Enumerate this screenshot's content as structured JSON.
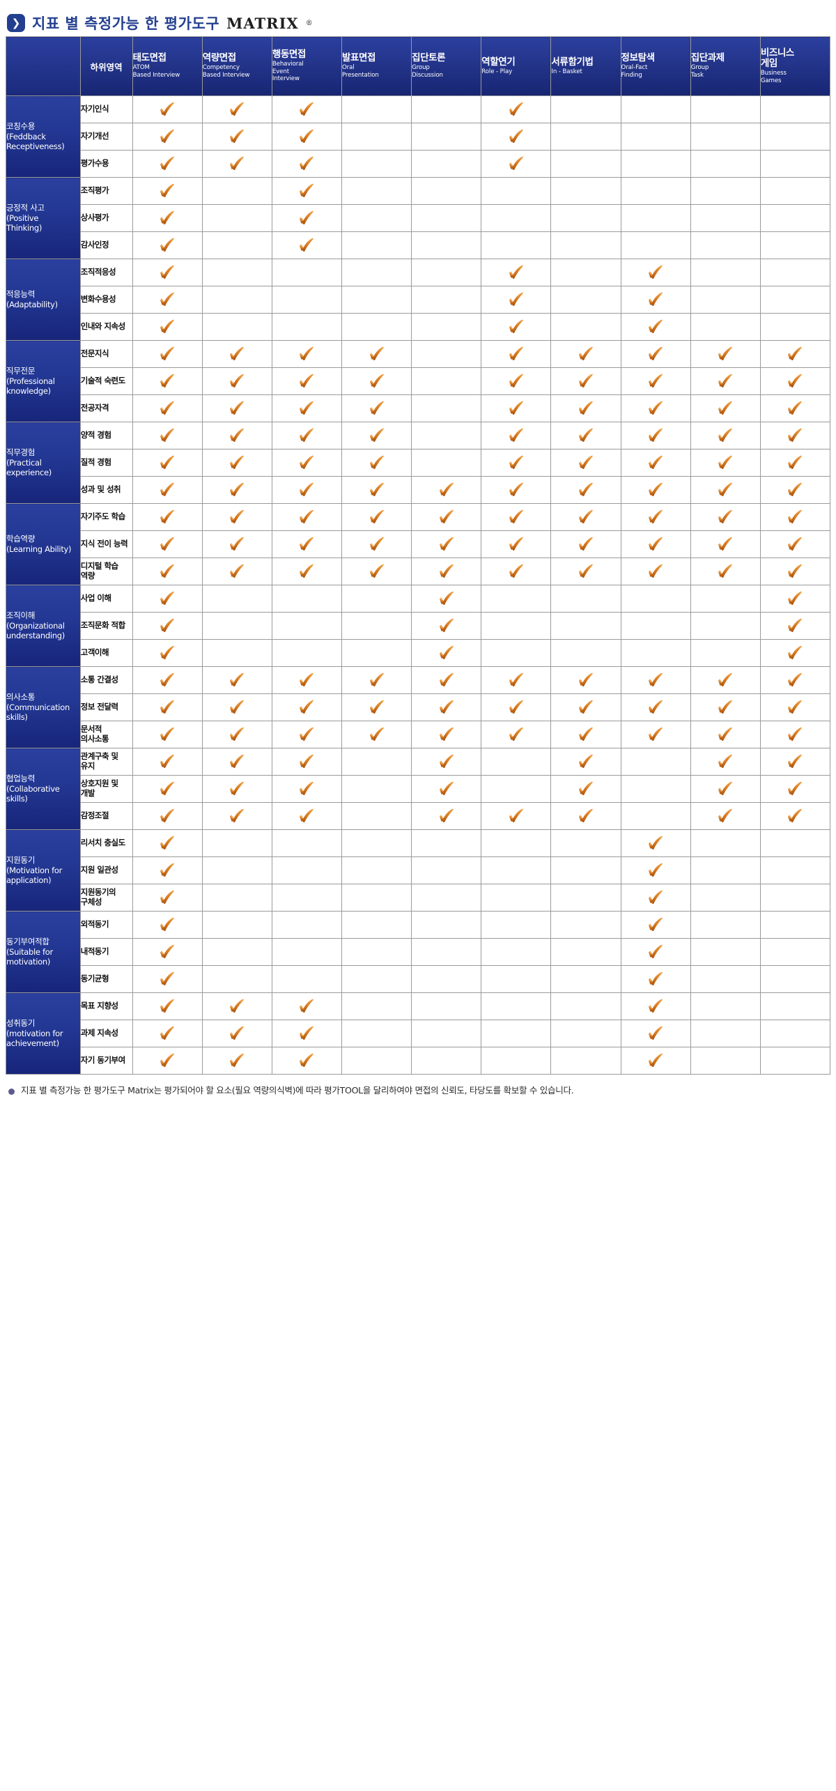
{
  "page": {
    "title_kr": "지표 별 측정가능 한 평가도구",
    "title_matrix": "MATRIX",
    "title_reg": "®",
    "chevron_icon": "chevron-right-icon",
    "accent_color": "#233f8f",
    "header_bg": "#23348a",
    "check_color": "#d4761e"
  },
  "header": {
    "category_label": "",
    "subarea_label": "하위영역",
    "tools": [
      {
        "kr": "태도면접",
        "en": "ATOM\nBased Interview"
      },
      {
        "kr": "역량면접",
        "en": "Competency\nBased Interview"
      },
      {
        "kr": "행동면접",
        "en": "Behavioral\nEvent\nInterview"
      },
      {
        "kr": "발표면접",
        "en": "Oral\nPresentation"
      },
      {
        "kr": "집단토론",
        "en": "Group\nDiscussion"
      },
      {
        "kr": "역할연기",
        "en": "Role - Play"
      },
      {
        "kr": "서류함기법",
        "en": "In - Basket"
      },
      {
        "kr": "정보탐색",
        "en": "Oral-Fact\nFinding"
      },
      {
        "kr": "집단과제",
        "en": "Group\nTask"
      },
      {
        "kr": "비즈니스\n게임",
        "en": "Business\nGames"
      }
    ]
  },
  "categories": [
    {
      "kr": "코칭수용",
      "en": "(Feddback\nReceptiveness)",
      "rows": [
        {
          "sub": "자기인식",
          "marks": [
            1,
            1,
            1,
            0,
            0,
            1,
            0,
            0,
            0,
            0
          ]
        },
        {
          "sub": "자기개선",
          "marks": [
            1,
            1,
            1,
            0,
            0,
            1,
            0,
            0,
            0,
            0
          ]
        },
        {
          "sub": "평가수용",
          "marks": [
            1,
            1,
            1,
            0,
            0,
            1,
            0,
            0,
            0,
            0
          ]
        }
      ]
    },
    {
      "kr": "긍정적 사고",
      "en": "(Positive\nThinking)",
      "rows": [
        {
          "sub": "조직평가",
          "marks": [
            1,
            0,
            1,
            0,
            0,
            0,
            0,
            0,
            0,
            0
          ]
        },
        {
          "sub": "상사평가",
          "marks": [
            1,
            0,
            1,
            0,
            0,
            0,
            0,
            0,
            0,
            0
          ]
        },
        {
          "sub": "감사인정",
          "marks": [
            1,
            0,
            1,
            0,
            0,
            0,
            0,
            0,
            0,
            0
          ]
        }
      ]
    },
    {
      "kr": "적응능력",
      "en": "(Adaptability)",
      "rows": [
        {
          "sub": "조직적응성",
          "marks": [
            1,
            0,
            0,
            0,
            0,
            1,
            0,
            1,
            0,
            0
          ]
        },
        {
          "sub": "변화수용성",
          "marks": [
            1,
            0,
            0,
            0,
            0,
            1,
            0,
            1,
            0,
            0
          ]
        },
        {
          "sub": "인내와 지속성",
          "marks": [
            1,
            0,
            0,
            0,
            0,
            1,
            0,
            1,
            0,
            0
          ]
        }
      ]
    },
    {
      "kr": "직무전문",
      "en": "(Professional\nknowledge)",
      "rows": [
        {
          "sub": "전문지식",
          "marks": [
            1,
            1,
            1,
            1,
            0,
            1,
            1,
            1,
            1,
            1
          ]
        },
        {
          "sub": "기술적 숙련도",
          "marks": [
            1,
            1,
            1,
            1,
            0,
            1,
            1,
            1,
            1,
            1
          ]
        },
        {
          "sub": "전공자격",
          "marks": [
            1,
            1,
            1,
            1,
            0,
            1,
            1,
            1,
            1,
            1
          ]
        }
      ]
    },
    {
      "kr": "직무경험",
      "en": "(Practical\nexperience)",
      "rows": [
        {
          "sub": "양적 경험",
          "marks": [
            1,
            1,
            1,
            1,
            0,
            1,
            1,
            1,
            1,
            1
          ]
        },
        {
          "sub": "질적 경험",
          "marks": [
            1,
            1,
            1,
            1,
            0,
            1,
            1,
            1,
            1,
            1
          ]
        },
        {
          "sub": "성과 및 성취",
          "marks": [
            1,
            1,
            1,
            1,
            1,
            1,
            1,
            1,
            1,
            1
          ]
        }
      ]
    },
    {
      "kr": "학습역량",
      "en": "(Learning Ability)",
      "rows": [
        {
          "sub": "자기주도 학습",
          "marks": [
            1,
            1,
            1,
            1,
            1,
            1,
            1,
            1,
            1,
            1
          ]
        },
        {
          "sub": "지식 전이 능력",
          "marks": [
            1,
            1,
            1,
            1,
            1,
            1,
            1,
            1,
            1,
            1
          ]
        },
        {
          "sub": "디지털 학습\n역량",
          "marks": [
            1,
            1,
            1,
            1,
            1,
            1,
            1,
            1,
            1,
            1
          ]
        }
      ]
    },
    {
      "kr": "조직이해",
      "en": "(Organizational\nunderstanding)",
      "rows": [
        {
          "sub": "사업 이해",
          "marks": [
            1,
            0,
            0,
            0,
            1,
            0,
            0,
            0,
            0,
            1
          ]
        },
        {
          "sub": "조직문화 적합",
          "marks": [
            1,
            0,
            0,
            0,
            1,
            0,
            0,
            0,
            0,
            1
          ]
        },
        {
          "sub": "고객이해",
          "marks": [
            1,
            0,
            0,
            0,
            1,
            0,
            0,
            0,
            0,
            1
          ]
        }
      ]
    },
    {
      "kr": "의사소통",
      "en": "(Communication\nskills)",
      "rows": [
        {
          "sub": "소통 간결성",
          "marks": [
            1,
            1,
            1,
            1,
            1,
            1,
            1,
            1,
            1,
            1
          ]
        },
        {
          "sub": "정보 전달력",
          "marks": [
            1,
            1,
            1,
            1,
            1,
            1,
            1,
            1,
            1,
            1
          ]
        },
        {
          "sub": "문서적\n의사소통",
          "marks": [
            1,
            1,
            1,
            1,
            1,
            1,
            1,
            1,
            1,
            1
          ]
        }
      ]
    },
    {
      "kr": "협업능력",
      "en": "(Collaborative\nskills)",
      "rows": [
        {
          "sub": "관계구축 및\n유지",
          "marks": [
            1,
            1,
            1,
            0,
            1,
            0,
            1,
            0,
            1,
            1
          ]
        },
        {
          "sub": "상호지원 및\n개발",
          "marks": [
            1,
            1,
            1,
            0,
            1,
            0,
            1,
            0,
            1,
            1
          ]
        },
        {
          "sub": "감정조절",
          "marks": [
            1,
            1,
            1,
            0,
            1,
            1,
            1,
            0,
            1,
            1
          ]
        }
      ]
    },
    {
      "kr": "지원동기",
      "en": "(Motivation for\napplication)",
      "rows": [
        {
          "sub": "리서치 충실도",
          "marks": [
            1,
            0,
            0,
            0,
            0,
            0,
            0,
            1,
            0,
            0
          ]
        },
        {
          "sub": "지원 일관성",
          "marks": [
            1,
            0,
            0,
            0,
            0,
            0,
            0,
            1,
            0,
            0
          ]
        },
        {
          "sub": "지원동기의\n구체성",
          "marks": [
            1,
            0,
            0,
            0,
            0,
            0,
            0,
            1,
            0,
            0
          ]
        }
      ]
    },
    {
      "kr": "동기부여적합",
      "en": "(Suitable for\nmotivation)",
      "rows": [
        {
          "sub": "외적동기",
          "marks": [
            1,
            0,
            0,
            0,
            0,
            0,
            0,
            1,
            0,
            0
          ]
        },
        {
          "sub": "내적동기",
          "marks": [
            1,
            0,
            0,
            0,
            0,
            0,
            0,
            1,
            0,
            0
          ]
        },
        {
          "sub": "동기균형",
          "marks": [
            1,
            0,
            0,
            0,
            0,
            0,
            0,
            1,
            0,
            0
          ]
        }
      ]
    },
    {
      "kr": "성취동기",
      "en": "(motivation for\nachievement)",
      "rows": [
        {
          "sub": "목표 지향성",
          "marks": [
            1,
            1,
            1,
            0,
            0,
            0,
            0,
            1,
            0,
            0
          ]
        },
        {
          "sub": "과제 지속성",
          "marks": [
            1,
            1,
            1,
            0,
            0,
            0,
            0,
            1,
            0,
            0
          ]
        },
        {
          "sub": "자기 동기부여",
          "marks": [
            1,
            1,
            1,
            0,
            0,
            0,
            0,
            1,
            0,
            0
          ]
        }
      ]
    }
  ],
  "footer": {
    "bullet_icon": "bullet-dot-icon",
    "note": "지표 별 측정가능 한 평가도구 Matrix는 평가되어야 할 요소(필요 역량의식벽)에 따라 평가TOOL을  달리하여야 면접의 신뢰도, 타당도를 확보할 수 있습니다."
  }
}
